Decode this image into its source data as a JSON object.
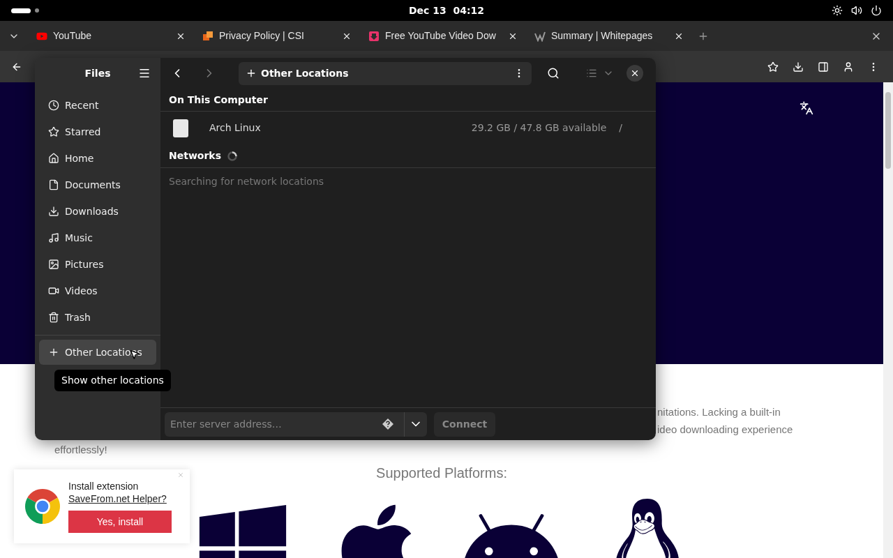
{
  "top_bar": {
    "clock": "Dec 13  04:12"
  },
  "browser": {
    "tabs": [
      {
        "title": "YouTube",
        "kind": "youtube"
      },
      {
        "title": "Privacy Policy | CSI",
        "kind": "csi"
      },
      {
        "title": "Free YouTube Video Dow",
        "kind": "download"
      },
      {
        "title": "Summary | Whitepages",
        "kind": "whitepages"
      }
    ],
    "page": {
      "text_lines": [
        "nitations. Lacking a built-in",
        "ideo downloading experience"
      ],
      "tail": "effortlessly!",
      "heading": "Supported Platforms:",
      "extension_prompt": {
        "title": "Install extension",
        "link": "SaveFrom.net Helper?",
        "button": "Yes, install"
      }
    }
  },
  "files": {
    "title": "Files",
    "path": "Other Locations",
    "sidebar": [
      {
        "label": "Recent",
        "kind": "recent",
        "selected": false
      },
      {
        "label": "Starred",
        "kind": "starred",
        "selected": false
      },
      {
        "label": "Home",
        "kind": "home",
        "selected": false
      },
      {
        "label": "Documents",
        "kind": "documents",
        "selected": false
      },
      {
        "label": "Downloads",
        "kind": "downloads",
        "selected": false
      },
      {
        "label": "Music",
        "kind": "music",
        "selected": false
      },
      {
        "label": "Pictures",
        "kind": "pictures",
        "selected": false
      },
      {
        "label": "Videos",
        "kind": "videos",
        "selected": false
      },
      {
        "label": "Trash",
        "kind": "trash",
        "selected": false
      }
    ],
    "other_locations": {
      "label": "Other Locations",
      "selected": true
    },
    "tooltip": "Show other locations",
    "on_this_computer": {
      "heading": "On This Computer",
      "drives": [
        {
          "name": "Arch Linux",
          "space": "29.2 GB / 47.8 GB available",
          "mount": "/"
        }
      ]
    },
    "networks": {
      "heading": "Networks",
      "status": "Searching for network locations"
    },
    "server": {
      "placeholder": "Enter server address…",
      "connect": "Connect"
    }
  }
}
